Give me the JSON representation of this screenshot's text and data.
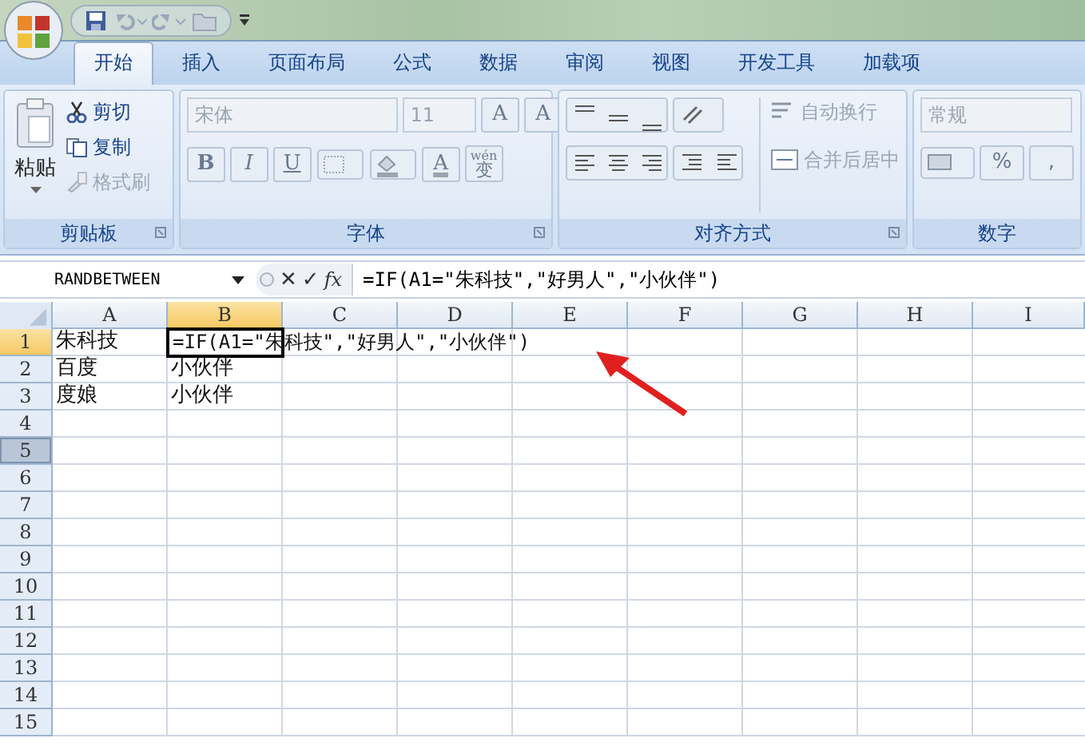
{
  "tabs": [
    {
      "label": "开始",
      "selected": true
    },
    {
      "label": "插入",
      "selected": false
    },
    {
      "label": "页面布局",
      "selected": false
    },
    {
      "label": "公式",
      "selected": false
    },
    {
      "label": "数据",
      "selected": false
    },
    {
      "label": "审阅",
      "selected": false
    },
    {
      "label": "视图",
      "selected": false
    },
    {
      "label": "开发工具",
      "selected": false
    },
    {
      "label": "加载项",
      "selected": false
    }
  ],
  "ribbon": {
    "groups": [
      {
        "kind": "clipboard",
        "label": "剪贴板",
        "paste": "粘贴",
        "items": [
          {
            "label": "剪切",
            "disabled": false
          },
          {
            "label": "复制",
            "disabled": false
          },
          {
            "label": "格式刷",
            "disabled": true
          }
        ]
      },
      {
        "kind": "font",
        "label": "字体",
        "font_name": "宋体",
        "font_size": "11",
        "grow": "A",
        "shrink": "A",
        "styles": [
          "B",
          "I",
          "U"
        ],
        "font_color": "A",
        "phonetic": {
          "top": "wén",
          "glyph": "变"
        }
      },
      {
        "kind": "alignment",
        "label": "对齐方式",
        "items": [
          {
            "label": "自动换行",
            "disabled": true
          },
          {
            "label": "合并后居中",
            "disabled": true
          }
        ]
      },
      {
        "kind": "number",
        "label": "数字",
        "format": "常规",
        "symbols": [
          "%",
          ","
        ]
      }
    ]
  },
  "formula_bar": {
    "name_box": "RANDBETWEEN",
    "cancel": "✕",
    "enter": "✓",
    "fx": "fx",
    "formula": "=IF(A1=\"朱科技\",\"好男人\",\"小伙伴\")"
  },
  "sheet": {
    "columns": [
      {
        "label": "A",
        "selected": false
      },
      {
        "label": "B",
        "selected": true
      },
      {
        "label": "C",
        "selected": false
      },
      {
        "label": "D",
        "selected": false
      },
      {
        "label": "E",
        "selected": false
      },
      {
        "label": "F",
        "selected": false
      },
      {
        "label": "G",
        "selected": false
      },
      {
        "label": "H",
        "selected": false
      },
      {
        "label": "I",
        "selected": false
      }
    ],
    "rows": [
      {
        "label": "1",
        "selected": true,
        "hovered": false,
        "cells": [
          {
            "text": "朱科技",
            "editing": false
          },
          {
            "text": "=IF(A1=\"朱科技\",\"好男人\",\"小伙伴\")",
            "editing": true
          }
        ]
      },
      {
        "label": "2",
        "selected": false,
        "hovered": false,
        "cells": [
          {
            "text": "百度",
            "editing": false
          },
          {
            "text": "小伙伴",
            "editing": false
          }
        ]
      },
      {
        "label": "3",
        "selected": false,
        "hovered": false,
        "cells": [
          {
            "text": "度娘",
            "editing": false
          },
          {
            "text": "小伙伴",
            "editing": false
          }
        ]
      },
      {
        "label": "4",
        "selected": false,
        "hovered": false,
        "cells": []
      },
      {
        "label": "5",
        "selected": false,
        "hovered": true,
        "cells": []
      },
      {
        "label": "6",
        "selected": false,
        "hovered": false,
        "cells": []
      },
      {
        "label": "7",
        "selected": false,
        "hovered": false,
        "cells": []
      },
      {
        "label": "8",
        "selected": false,
        "hovered": false,
        "cells": []
      },
      {
        "label": "9",
        "selected": false,
        "hovered": false,
        "cells": []
      },
      {
        "label": "10",
        "selected": false,
        "hovered": false,
        "cells": []
      },
      {
        "label": "11",
        "selected": false,
        "hovered": false,
        "cells": []
      },
      {
        "label": "12",
        "selected": false,
        "hovered": false,
        "cells": []
      },
      {
        "label": "13",
        "selected": false,
        "hovered": false,
        "cells": []
      },
      {
        "label": "14",
        "selected": false,
        "hovered": false,
        "cells": []
      },
      {
        "label": "15",
        "selected": false,
        "hovered": false,
        "cells": []
      }
    ]
  }
}
